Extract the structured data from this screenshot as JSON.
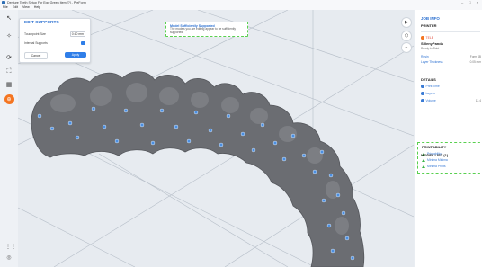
{
  "window": {
    "title": "Denture Teeth Setup For Egg Green Item [?] - PreForm",
    "controls": [
      "–",
      "□",
      "×"
    ]
  },
  "menu": [
    "File",
    "Edit",
    "View",
    "Help"
  ],
  "left_toolbar": [
    {
      "name": "select-tool-icon",
      "glyph": "↖"
    },
    {
      "name": "magic-wand-icon",
      "glyph": "✧"
    },
    {
      "name": "orient-tool-icon",
      "glyph": "⟳"
    },
    {
      "name": "layout-tool-icon",
      "glyph": "⛶"
    },
    {
      "name": "print-tool-icon",
      "glyph": "▦"
    },
    {
      "name": "supports-tool-icon",
      "glyph": "⊕"
    }
  ],
  "edit_supports": {
    "title": "EDIT SUPPORTS",
    "touchpoint_label": "Touchpoint Size",
    "touchpoint_value": "0.60 mm",
    "internal_label": "Internal Supports",
    "cancel": "Cancel",
    "apply": "Apply"
  },
  "notice": {
    "title": "Model Sufficiently Supported",
    "body": "The models you are editing appear to be sufficiently supported."
  },
  "job_info": {
    "section": "JOB INFO",
    "printer_label": "PRINTER",
    "resin_tag": "TELE",
    "printer_name": "SillenyPanda",
    "status": "Ready to Print",
    "resin_label": "Resin",
    "resin_value": "Form 4B",
    "layer_label": "Layer Thickness",
    "layer_value": "0.05 mm",
    "details_section": "DETAILS",
    "print_time": "Print Time",
    "layers": "Layers",
    "volume": "Volume",
    "volume_value": "12.4",
    "printability_section": "PRINTABILITY",
    "printability_items": [
      "Printability",
      "Minima Minima",
      "Minima Prints"
    ],
    "model_list": "MODEL LIST (1)"
  },
  "bottom_tools": [
    "grid-icon",
    "camera-icon"
  ],
  "colors": {
    "accent": "#2f7ee8",
    "orange": "#f47521",
    "green_highlight": "#59d04f",
    "model_gray": "#6b6d72",
    "support_point": "#4c8fe0"
  }
}
